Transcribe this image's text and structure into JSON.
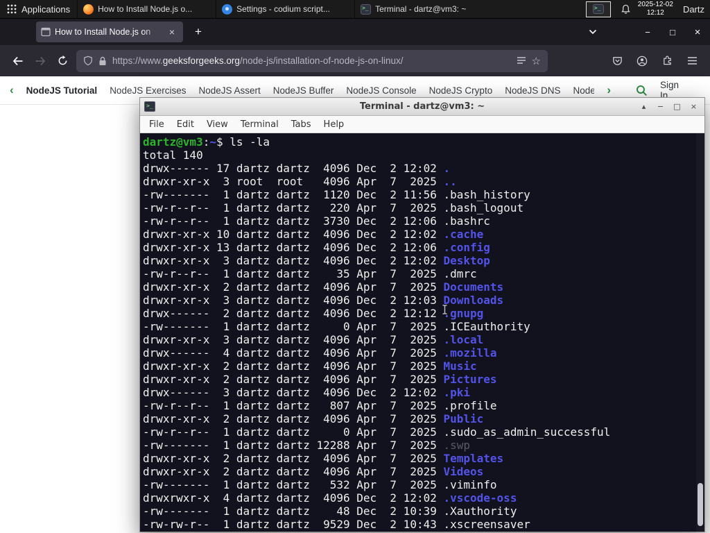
{
  "panel": {
    "applications_label": "Applications",
    "tasks": [
      {
        "icon": "firefox",
        "title": "How to Install Node.js o..."
      },
      {
        "icon": "settings",
        "title": "Settings - codium script..."
      },
      {
        "icon": "terminal",
        "title": "Terminal - dartz@vm3: ~"
      }
    ],
    "clock": {
      "date": "2025-12-02",
      "time": "12:12"
    },
    "user": "Dartz"
  },
  "browser": {
    "tab": {
      "title": "How to Install Node.js on",
      "close": "×"
    },
    "new_tab": "+",
    "window_controls": {
      "minimize": "−",
      "maximize": "□",
      "close": "×"
    },
    "url": {
      "prefix": "https://www.",
      "domain": "geeksforgeeks.org",
      "path": "/node-js/installation-of-node-js-on-linux/"
    },
    "bookmark_star": "☆"
  },
  "gfg_nav": {
    "chevron_left": "‹",
    "chevron_right": "›",
    "items": [
      "NodeJS Tutorial",
      "NodeJS Exercises",
      "NodeJS Assert",
      "NodeJS Buffer",
      "NodeJS Console",
      "NodeJS Crypto",
      "NodeJS DNS",
      "Node"
    ],
    "sign_in": "Sign In",
    "accent_green": "#2f8d46"
  },
  "terminal": {
    "window_title": "Terminal - dartz@vm3: ~",
    "window_buttons": {
      "shade": "▴",
      "minimize": "−",
      "maximize": "□",
      "close": "×"
    },
    "menu": [
      "File",
      "Edit",
      "View",
      "Terminal",
      "Tabs",
      "Help"
    ],
    "prompt_user_host": "dartz@vm3",
    "prompt_separator": ":",
    "prompt_path": "~",
    "prompt_suffix": "$ ",
    "command": "ls -la",
    "total_line": "total 140",
    "colors": {
      "background": "#12121e",
      "foreground": "#efefef",
      "prompt_green": "#2db42d",
      "dir_blue": "#5353ea",
      "dim": "#5a5a66"
    },
    "entries": [
      {
        "meta": "drwx------ 17 dartz dartz  4096 Dec  2 12:02 ",
        "name": ".",
        "color": "dir"
      },
      {
        "meta": "drwxr-xr-x  3 root  root   4096 Apr  7  2025 ",
        "name": "..",
        "color": "dir"
      },
      {
        "meta": "-rw-------  1 dartz dartz  1120 Dec  2 11:56 ",
        "name": ".bash_history",
        "color": "file"
      },
      {
        "meta": "-rw-r--r--  1 dartz dartz   220 Apr  7  2025 ",
        "name": ".bash_logout",
        "color": "file"
      },
      {
        "meta": "-rw-r--r--  1 dartz dartz  3730 Dec  2 12:06 ",
        "name": ".bashrc",
        "color": "file"
      },
      {
        "meta": "drwxr-xr-x 10 dartz dartz  4096 Dec  2 12:02 ",
        "name": ".cache",
        "color": "dir"
      },
      {
        "meta": "drwxr-xr-x 13 dartz dartz  4096 Dec  2 12:06 ",
        "name": ".config",
        "color": "dir"
      },
      {
        "meta": "drwxr-xr-x  3 dartz dartz  4096 Dec  2 12:02 ",
        "name": "Desktop",
        "color": "dir"
      },
      {
        "meta": "-rw-r--r--  1 dartz dartz    35 Apr  7  2025 ",
        "name": ".dmrc",
        "color": "file"
      },
      {
        "meta": "drwxr-xr-x  2 dartz dartz  4096 Apr  7  2025 ",
        "name": "Documents",
        "color": "dir"
      },
      {
        "meta": "drwxr-xr-x  3 dartz dartz  4096 Dec  2 12:03 ",
        "name": "Downloads",
        "color": "dir"
      },
      {
        "meta": "drwx------  2 dartz dartz  4096 Dec  2 12:12 ",
        "name": ".gnupg",
        "color": "dir"
      },
      {
        "meta": "-rw-------  1 dartz dartz     0 Apr  7  2025 ",
        "name": ".ICEauthority",
        "color": "file"
      },
      {
        "meta": "drwxr-xr-x  3 dartz dartz  4096 Apr  7  2025 ",
        "name": ".local",
        "color": "dir"
      },
      {
        "meta": "drwx------  4 dartz dartz  4096 Apr  7  2025 ",
        "name": ".mozilla",
        "color": "dir"
      },
      {
        "meta": "drwxr-xr-x  2 dartz dartz  4096 Apr  7  2025 ",
        "name": "Music",
        "color": "dir"
      },
      {
        "meta": "drwxr-xr-x  2 dartz dartz  4096 Apr  7  2025 ",
        "name": "Pictures",
        "color": "dir"
      },
      {
        "meta": "drwx------  3 dartz dartz  4096 Dec  2 12:02 ",
        "name": ".pki",
        "color": "dir"
      },
      {
        "meta": "-rw-r--r--  1 dartz dartz   807 Apr  7  2025 ",
        "name": ".profile",
        "color": "file"
      },
      {
        "meta": "drwxr-xr-x  2 dartz dartz  4096 Apr  7  2025 ",
        "name": "Public",
        "color": "dir"
      },
      {
        "meta": "-rw-r--r--  1 dartz dartz     0 Apr  7  2025 ",
        "name": ".sudo_as_admin_successful",
        "color": "file"
      },
      {
        "meta": "-rw-------  1 dartz dartz 12288 Apr  7  2025 ",
        "name": ".swp",
        "color": "dim"
      },
      {
        "meta": "drwxr-xr-x  2 dartz dartz  4096 Apr  7  2025 ",
        "name": "Templates",
        "color": "dir"
      },
      {
        "meta": "drwxr-xr-x  2 dartz dartz  4096 Apr  7  2025 ",
        "name": "Videos",
        "color": "dir"
      },
      {
        "meta": "-rw-------  1 dartz dartz   532 Apr  7  2025 ",
        "name": ".viminfo",
        "color": "file"
      },
      {
        "meta": "drwxrwxr-x  4 dartz dartz  4096 Dec  2 12:02 ",
        "name": ".vscode-oss",
        "color": "dir"
      },
      {
        "meta": "-rw-------  1 dartz dartz    48 Dec  2 10:39 ",
        "name": ".Xauthority",
        "color": "file"
      },
      {
        "meta": "-rw-rw-r--  1 dartz dartz  9529 Dec  2 10:43 ",
        "name": ".xscreensaver",
        "color": "file"
      }
    ]
  }
}
